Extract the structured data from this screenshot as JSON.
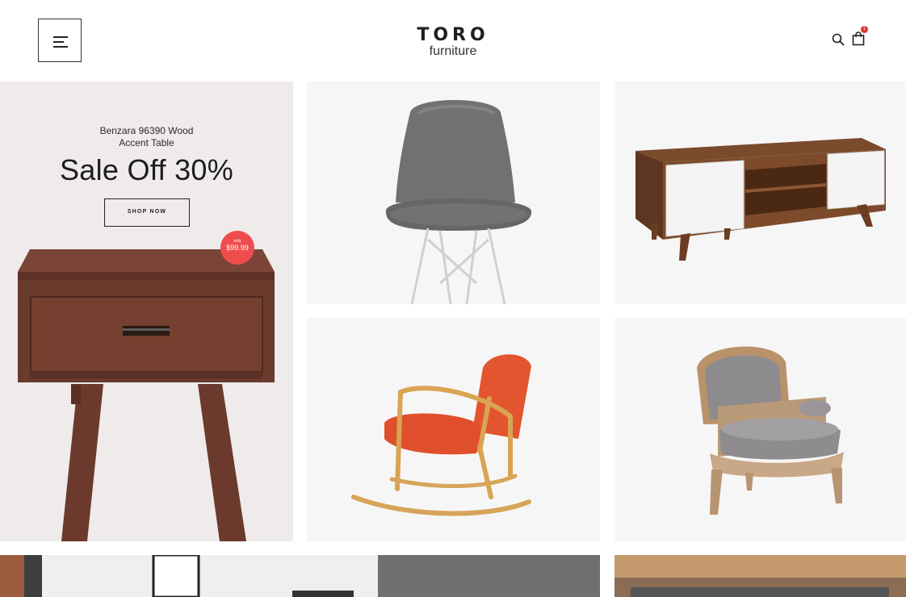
{
  "brand": {
    "name": "TORO",
    "tagline": "furniture"
  },
  "header": {
    "cart_count": "1"
  },
  "hero": {
    "product_line1": "Benzara 96390 Wood",
    "product_line2": "Accent Table",
    "headline": "Sale Off 30%",
    "cta_label": "SHOP NOW",
    "price_prefix": "only",
    "price": "$99.99"
  },
  "products": [
    {
      "icon": "grey-upholstered-chair"
    },
    {
      "icon": "walnut-tv-stand"
    },
    {
      "icon": "orange-rocking-chair"
    },
    {
      "icon": "grey-velvet-armchair"
    }
  ],
  "colors": {
    "accent": "#ef4d4d",
    "badge": "#e4322b",
    "tile_bg": "#f7f6f6",
    "hero_bg": "#efebeb"
  }
}
